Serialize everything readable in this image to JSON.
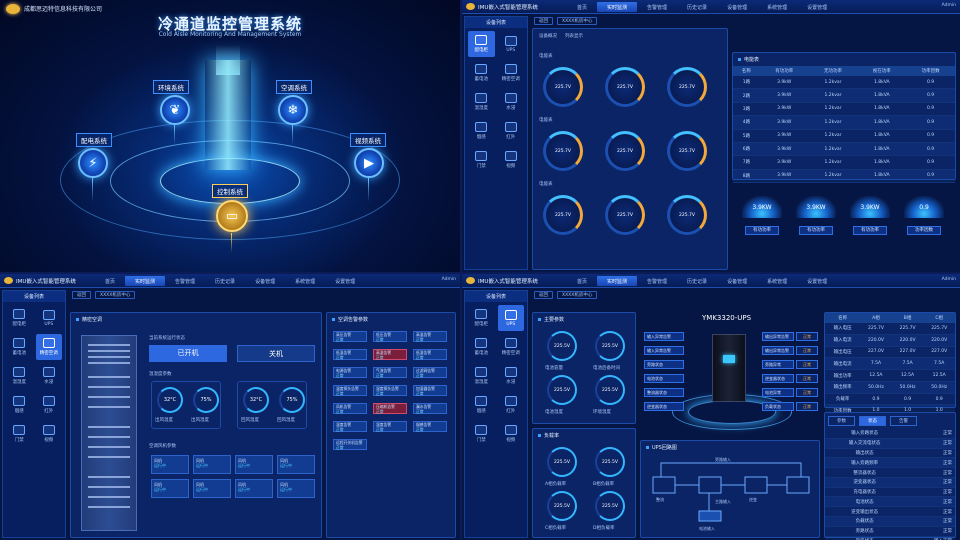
{
  "hero": {
    "company": "成都思迈特信息科技有限公司",
    "title": "冷通道监控管理系统",
    "subtitle": "Cold Aisle Monitoring And Management System",
    "nodes": {
      "env": "环境系统",
      "hvac": "空调系统",
      "power": "配电系统",
      "video": "视频系统",
      "control": "控制系统"
    },
    "icons": {
      "env": "leaf-icon",
      "hvac": "snowflake-icon",
      "power": "lightning-icon",
      "video": "camera-icon",
      "control": "battery-icon"
    }
  },
  "app": {
    "title": "IMU嵌入式智能管理系统",
    "nav": [
      "首页",
      "实时监测",
      "告警管理",
      "历史记录",
      "设备管理",
      "系统管理",
      "设置管理"
    ],
    "nav_active_index": 1,
    "user": "Admin",
    "sidebar_title": "设备列表",
    "sidebar_items": [
      "配电柜",
      "UPS",
      "蓄电池",
      "精密空调",
      "温湿度",
      "水浸",
      "烟感",
      "红外",
      "门禁",
      "视频"
    ],
    "colors": {
      "accent": "#2d68e0",
      "warn": "#f2a93b",
      "alarm": "#d14a6b"
    }
  },
  "power_screen": {
    "crumb": [
      "返回",
      "XXXX机房中心"
    ],
    "tabs": [
      "设备概况",
      "列表显示"
    ],
    "groups": [
      "电能表",
      "电能表",
      "电能表"
    ],
    "gauge_value": "225.7V",
    "gauge_unit": "1.2A",
    "table_title": "电能表",
    "table_headers": [
      "名称",
      "有功功率",
      "无功功率",
      "视在功率",
      "功率因数"
    ],
    "table_rows": [
      [
        "1路",
        "3.9kW",
        "1.2kvar",
        "1.8kVA",
        "0.9"
      ],
      [
        "2路",
        "3.9kW",
        "1.2kvar",
        "1.8kVA",
        "0.9"
      ],
      [
        "3路",
        "3.9kW",
        "1.2kvar",
        "1.8kVA",
        "0.9"
      ],
      [
        "4路",
        "3.9kW",
        "1.2kvar",
        "1.8kVA",
        "0.9"
      ],
      [
        "5路",
        "3.9kW",
        "1.2kvar",
        "1.8kVA",
        "0.9"
      ],
      [
        "6路",
        "3.9kW",
        "1.2kvar",
        "1.8kVA",
        "0.9"
      ],
      [
        "7路",
        "3.9kW",
        "1.2kvar",
        "1.8kVA",
        "0.9"
      ],
      [
        "8路",
        "3.9kW",
        "1.2kvar",
        "1.8kVA",
        "0.9"
      ]
    ],
    "discs": [
      "3.9KW",
      "3.9KW",
      "3.9KW",
      "0.9"
    ],
    "disc_buttons": [
      "有功功率",
      "有功功率",
      "有功功率",
      "功率因数"
    ]
  },
  "ac_screen": {
    "crumb": [
      "返回",
      "XXXX机房中心"
    ],
    "left_title": "精密空调",
    "state_label": "当前系统运行状态",
    "on_label": "已开机",
    "off_label": "关机",
    "temp_title": "温湿度参数",
    "temps": [
      {
        "value": "32°C",
        "label": "出风温度"
      },
      {
        "value": "75%",
        "label": "出风湿度"
      },
      {
        "value": "32°C",
        "label": "回风温度"
      },
      {
        "value": "75%",
        "label": "回风湿度"
      }
    ],
    "fan_title": "空调风机参数",
    "fans": [
      "风机",
      "风机",
      "风机",
      "风机",
      "风机",
      "风机",
      "风机",
      "风机"
    ],
    "fan_status": "运行中",
    "right_title": "空调告警参数",
    "alarm_labels": [
      "高压告警",
      "低压告警",
      "高温告警",
      "低温告警",
      "高湿告警",
      "低湿告警",
      "电源告警",
      "气流告警",
      "过滤网告警",
      "温度探头告警",
      "湿度探头告警",
      "加湿器告警",
      "风机告警",
      "压缩机告警",
      "漏水告警",
      "温度告警",
      "湿度告警",
      "烟感告警",
      "远程开关机告警"
    ],
    "alarm_red_indices": [
      4,
      13
    ],
    "alarm_state": "正常"
  },
  "ups_screen": {
    "crumb": [
      "返回",
      "XXXX机房中心"
    ],
    "model": "YMK3320-UPS",
    "main_title": "主要参数",
    "main_rings": [
      {
        "value": "225.5V",
        "label": "电池容量"
      },
      {
        "value": "225.5V",
        "label": "电池后备时间"
      },
      {
        "value": "225.5V",
        "label": "电池温度"
      },
      {
        "value": "225.5V",
        "label": "环境温度"
      }
    ],
    "load_title": "负载率",
    "load_rings": [
      {
        "value": "225.5V",
        "label": "A相负载率"
      },
      {
        "value": "225.5V",
        "label": "B相负载率"
      },
      {
        "value": "225.5V",
        "label": "C相负载率"
      },
      {
        "value": "225.5V",
        "label": "D相负载率"
      }
    ],
    "left_btns": [
      "输入异常告警",
      "输入异常告警",
      "旁路状态",
      "电池状态",
      "整流器状态",
      "逆变器状态"
    ],
    "right_btns": [
      "输出异常告警",
      "输出异常告警",
      "旁路异常",
      "逆变器状态",
      "电池异常",
      "负载状态"
    ],
    "btn_value": "正常",
    "diagram_title": "UPS回路图",
    "diagram_labels": [
      "旁路输入",
      "主路输入",
      "整流",
      "逆变",
      "电池输入"
    ],
    "table_headers": [
      "名称",
      "A相",
      "B相",
      "C相"
    ],
    "table_rows": [
      [
        "输入电压",
        "225.7V",
        "225.7V",
        "225.7V"
      ],
      [
        "输入电流",
        "220.0V",
        "220.0V",
        "220.0V"
      ],
      [
        "输出电压",
        "227.0V",
        "227.0V",
        "227.0V"
      ],
      [
        "输出电流",
        "7.5A",
        "7.5A",
        "7.5A"
      ],
      [
        "输出功率",
        "12.5A",
        "12.5A",
        "12.5A"
      ],
      [
        "输出频率",
        "50.0Hz",
        "50.0Hz",
        "50.0Hz"
      ],
      [
        "负载率",
        "0.9",
        "0.9",
        "0.9"
      ],
      [
        "功率因数",
        "1.0",
        "1.0",
        "1.0"
      ]
    ],
    "tabs": [
      "参数",
      "状态",
      "告警"
    ],
    "list": [
      [
        "输入旁路状态",
        "正常"
      ],
      [
        "输入交流电状态",
        "正常"
      ],
      [
        "输出状态",
        "正常"
      ],
      [
        "输入旁路频率",
        "正常"
      ],
      [
        "整流器状态",
        "正常"
      ],
      [
        "逆变器状态",
        "正常"
      ],
      [
        "充电器状态",
        "正常"
      ],
      [
        "电池状态",
        "正常"
      ],
      [
        "逆变输出状态",
        "正常"
      ],
      [
        "负载状态",
        "正常"
      ],
      [
        "旁路状态",
        "正常"
      ],
      [
        "风扇状态",
        "输入正常"
      ],
      [
        "ECO模式状态",
        "正常"
      ],
      [
        "维护旁路状态",
        "正常"
      ]
    ]
  }
}
